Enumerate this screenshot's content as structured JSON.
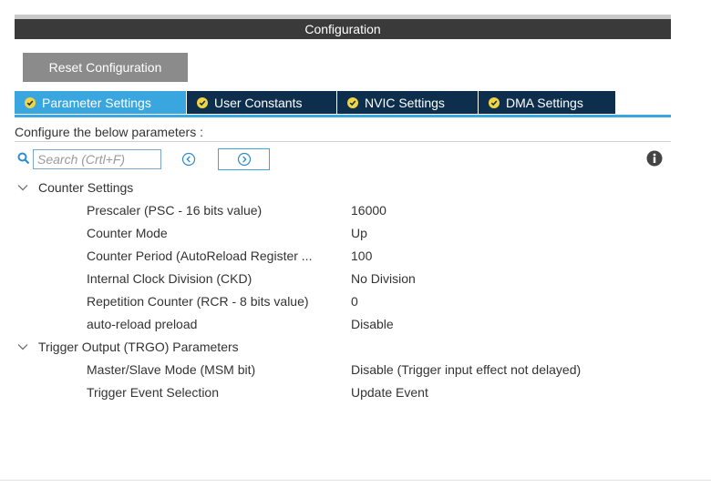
{
  "window": {
    "title": "Configuration"
  },
  "toolbar": {
    "reset_label": "Reset Configuration"
  },
  "tabs": [
    {
      "label": "Parameter Settings",
      "active": true
    },
    {
      "label": "User Constants",
      "active": false
    },
    {
      "label": "NVIC Settings",
      "active": false
    },
    {
      "label": "DMA Settings",
      "active": false
    }
  ],
  "hint": "Configure the below parameters :",
  "search": {
    "placeholder": "Search (Crtl+F)",
    "value": ""
  },
  "icons": {
    "search": "search-icon",
    "prev": "chevron-left-circle-icon",
    "next": "chevron-right-circle-icon",
    "info": "info-icon",
    "tab_status": "check-circle-icon",
    "group_toggle": "chevron-down-icon"
  },
  "colors": {
    "accent": "#3aa6e0",
    "tab_dark": "#0d2f4d",
    "title_bar": "#3a3a3a",
    "button": "#8b8b8b",
    "check": "#f2d442"
  },
  "groups": [
    {
      "label": "Counter Settings",
      "params": [
        {
          "name": "Prescaler (PSC - 16 bits value)",
          "value": "16000"
        },
        {
          "name": "Counter Mode",
          "value": "Up"
        },
        {
          "name": "Counter Period (AutoReload Register ...",
          "value": "100"
        },
        {
          "name": "Internal Clock Division (CKD)",
          "value": "No Division"
        },
        {
          "name": "Repetition Counter (RCR - 8 bits value)",
          "value": "0"
        },
        {
          "name": "auto-reload preload",
          "value": "Disable"
        }
      ]
    },
    {
      "label": "Trigger Output (TRGO) Parameters",
      "params": [
        {
          "name": "Master/Slave Mode (MSM bit)",
          "value": "Disable (Trigger input effect not delayed)"
        },
        {
          "name": "Trigger Event Selection",
          "value": "Update Event"
        }
      ]
    }
  ]
}
